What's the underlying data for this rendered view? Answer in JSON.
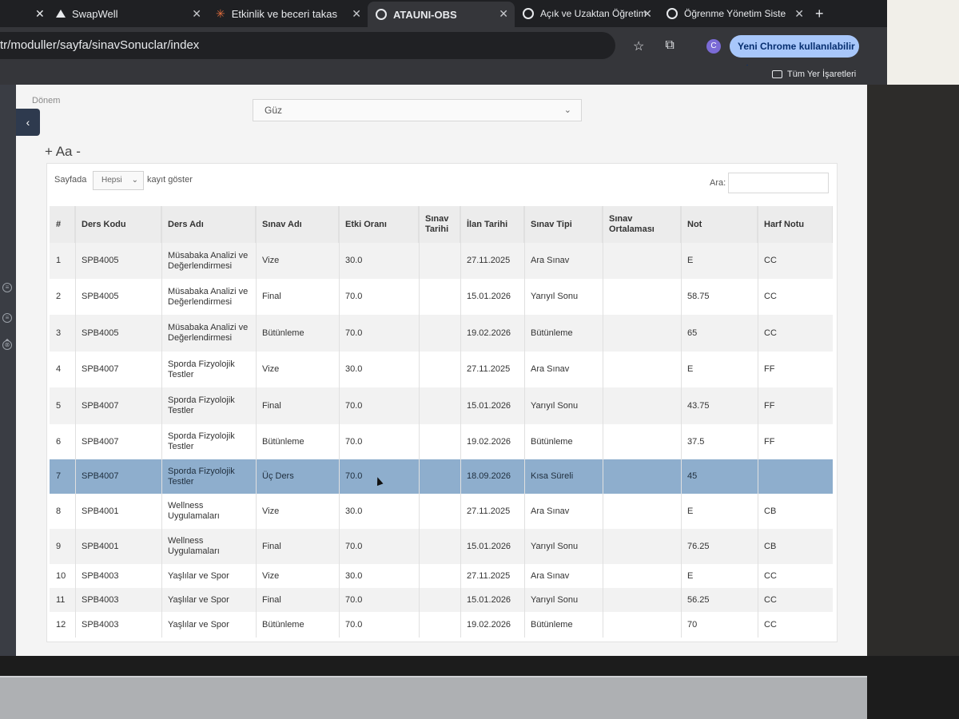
{
  "browser": {
    "tabs": [
      {
        "title": "",
        "favicon": "close-icon"
      },
      {
        "title": "SwapWell",
        "favicon": "triangle-icon"
      },
      {
        "title": "Etkinlik ve beceri takas",
        "favicon": "star-icon"
      },
      {
        "title": "ATAUNI-OBS",
        "favicon": "globe-icon",
        "active": true
      },
      {
        "title": "Açık ve Uzaktan Öğretim",
        "favicon": "globe-icon"
      },
      {
        "title": "Öğrenme Yönetim Siste",
        "favicon": "globe-icon"
      }
    ],
    "url": "tr/moduller/sayfa/sinavSonuclar/index",
    "profile_initial": "C",
    "update_button": "Yeni Chrome kullanılabilir",
    "bookmarks_label": "Tüm Yer İşaretleri"
  },
  "filters": {
    "donem_label": "Dönem",
    "donem_value": "Güz",
    "font_controls": "+ Aa -"
  },
  "table_controls": {
    "sayfada": "Sayfada",
    "page_length": "Hepsi",
    "kayit_goster": "kayıt göster",
    "search_label": "Ara:"
  },
  "columns": [
    "#",
    "Ders Kodu",
    "Ders Adı",
    "Sınav Adı",
    "Etki Oranı",
    "Sınav Tarihi",
    "İlan Tarihi",
    "Sınav Tipi",
    "Sınav Ortalaması",
    "Not",
    "Harf Notu"
  ],
  "rows": [
    {
      "no": "1",
      "kod": "SPB4005",
      "ad": "Müsabaka Analizi ve Değerlendirmesi",
      "sinav": "Vize",
      "etki": "30.0",
      "tarih": "",
      "ilan": "27.11.2025",
      "tip": "Ara Sınav",
      "ort": "",
      "not": "E",
      "harf": "CC"
    },
    {
      "no": "2",
      "kod": "SPB4005",
      "ad": "Müsabaka Analizi ve Değerlendirmesi",
      "sinav": "Final",
      "etki": "70.0",
      "tarih": "",
      "ilan": "15.01.2026",
      "tip": "Yarıyıl Sonu",
      "ort": "",
      "not": "58.75",
      "harf": "CC"
    },
    {
      "no": "3",
      "kod": "SPB4005",
      "ad": "Müsabaka Analizi ve Değerlendirmesi",
      "sinav": "Bütünleme",
      "etki": "70.0",
      "tarih": "",
      "ilan": "19.02.2026",
      "tip": "Bütünleme",
      "ort": "",
      "not": "65",
      "harf": "CC"
    },
    {
      "no": "4",
      "kod": "SPB4007",
      "ad": "Sporda Fizyolojik Testler",
      "sinav": "Vize",
      "etki": "30.0",
      "tarih": "",
      "ilan": "27.11.2025",
      "tip": "Ara Sınav",
      "ort": "",
      "not": "E",
      "harf": "FF"
    },
    {
      "no": "5",
      "kod": "SPB4007",
      "ad": "Sporda Fizyolojik Testler",
      "sinav": "Final",
      "etki": "70.0",
      "tarih": "",
      "ilan": "15.01.2026",
      "tip": "Yarıyıl Sonu",
      "ort": "",
      "not": "43.75",
      "harf": "FF"
    },
    {
      "no": "6",
      "kod": "SPB4007",
      "ad": "Sporda Fizyolojik Testler",
      "sinav": "Bütünleme",
      "etki": "70.0",
      "tarih": "",
      "ilan": "19.02.2026",
      "tip": "Bütünleme",
      "ort": "",
      "not": "37.5",
      "harf": "FF"
    },
    {
      "no": "7",
      "kod": "SPB4007",
      "ad": "Sporda Fizyolojik Testler",
      "sinav": "Üç Ders",
      "etki": "70.0",
      "tarih": "",
      "ilan": "18.09.2026",
      "tip": "Kısa Süreli",
      "ort": "",
      "not": "45",
      "harf": "",
      "selected": true
    },
    {
      "no": "8",
      "kod": "SPB4001",
      "ad": "Wellness Uygulamaları",
      "sinav": "Vize",
      "etki": "30.0",
      "tarih": "",
      "ilan": "27.11.2025",
      "tip": "Ara Sınav",
      "ort": "",
      "not": "E",
      "harf": "CB"
    },
    {
      "no": "9",
      "kod": "SPB4001",
      "ad": "Wellness Uygulamaları",
      "sinav": "Final",
      "etki": "70.0",
      "tarih": "",
      "ilan": "15.01.2026",
      "tip": "Yarıyıl Sonu",
      "ort": "",
      "not": "76.25",
      "harf": "CB"
    },
    {
      "no": "10",
      "kod": "SPB4003",
      "ad": "Yaşlılar ve Spor",
      "sinav": "Vize",
      "etki": "30.0",
      "tarih": "",
      "ilan": "27.11.2025",
      "tip": "Ara Sınav",
      "ort": "",
      "not": "E",
      "harf": "CC"
    },
    {
      "no": "11",
      "kod": "SPB4003",
      "ad": "Yaşlılar ve Spor",
      "sinav": "Final",
      "etki": "70.0",
      "tarih": "",
      "ilan": "15.01.2026",
      "tip": "Yarıyıl Sonu",
      "ort": "",
      "not": "56.25",
      "harf": "CC"
    },
    {
      "no": "12",
      "kod": "SPB4003",
      "ad": "Yaşlılar ve Spor",
      "sinav": "Bütünleme",
      "etki": "70.0",
      "tarih": "",
      "ilan": "19.02.2026",
      "tip": "Bütünleme",
      "ort": "",
      "not": "70",
      "harf": "CC"
    }
  ],
  "colors": {
    "selected_row": "#8eaecd",
    "chrome_button": "#a8c7fa",
    "sidebar_toggle": "#2e3a4e"
  }
}
